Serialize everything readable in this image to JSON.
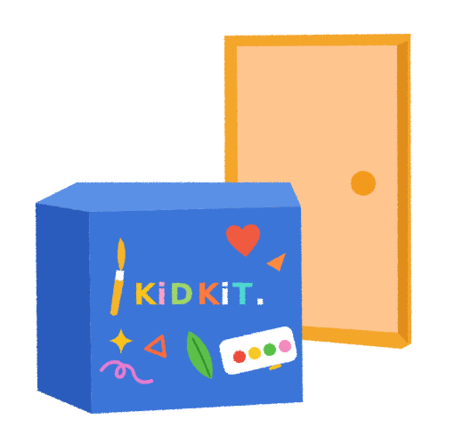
{
  "illustration": {
    "brand_letters": [
      {
        "char": "K",
        "color": "#f9c21a"
      },
      {
        "char": "i",
        "color": "#f7a1c4"
      },
      {
        "char": "D",
        "color": "#9fd56b"
      },
      {
        "char": "K",
        "color": "#ff7a3d"
      },
      {
        "char": "i",
        "color": "#ffffff"
      },
      {
        "char": "T",
        "color": "#4fd6d0"
      },
      {
        "char": ".",
        "color": "#ffffff"
      }
    ],
    "colors": {
      "box_front": "#3b74d8",
      "box_side": "#2a5bbd",
      "box_top": "#5a90e6",
      "door_frame": "#f4a62a",
      "door_panel": "#ffc58f",
      "door_knob": "#f39a1c",
      "heart": "#ef5a3f",
      "leaf": "#5cbf4a",
      "palette": "#ffffff",
      "paint_red": "#ef4b3a",
      "paint_yellow": "#f8c825",
      "paint_green": "#59c04a",
      "paint_pink": "#f28bbd",
      "squiggle": "#e57bd0",
      "triangle": "#ff6b3d",
      "sparkle": "#f9c21a",
      "brush": "#f5b42a"
    },
    "icons": [
      "box-icon",
      "door-icon",
      "paintbrush-icon",
      "heart-icon",
      "triangle-icon",
      "sparkle-icon",
      "leaf-icon",
      "paint-palette-icon",
      "squiggle-icon"
    ]
  }
}
